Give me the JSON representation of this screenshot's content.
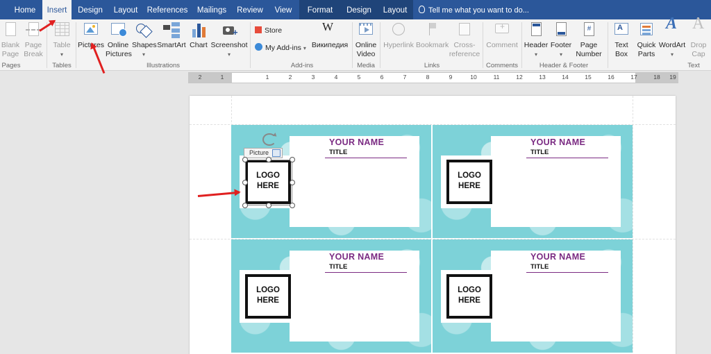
{
  "tabs": [
    {
      "label": "Home"
    },
    {
      "label": "Insert"
    },
    {
      "label": "Design"
    },
    {
      "label": "Layout"
    },
    {
      "label": "References"
    },
    {
      "label": "Mailings"
    },
    {
      "label": "Review"
    },
    {
      "label": "View"
    },
    {
      "label": "Format"
    },
    {
      "label": "Design"
    },
    {
      "label": "Layout"
    }
  ],
  "active_tab": "Insert",
  "tell_me": "Tell me what you want to do...",
  "ribbon": {
    "pages": {
      "label": "Pages",
      "blank": [
        "Blank",
        "Page"
      ],
      "break": [
        "Page",
        "Break"
      ]
    },
    "tables": {
      "label": "Tables",
      "table": "Table"
    },
    "illustrations": {
      "label": "Illustrations",
      "pictures": "Pictures",
      "online_pictures": [
        "Online",
        "Pictures"
      ],
      "shapes": "Shapes",
      "smartart": "SmartArt",
      "chart": "Chart",
      "screenshot": "Screenshot"
    },
    "addins": {
      "label": "Add-ins",
      "store": "Store",
      "my_addins": "My Add-ins",
      "wiki": "Википедия",
      "wiki_glyph": "W"
    },
    "media": {
      "label": "Media",
      "online_video": [
        "Online",
        "Video"
      ]
    },
    "links": {
      "label": "Links",
      "hyperlink": "Hyperlink",
      "bookmark": "Bookmark",
      "cross_reference": [
        "Cross-",
        "reference"
      ]
    },
    "comments": {
      "label": "Comments",
      "comment": "Comment"
    },
    "header_footer": {
      "label": "Header & Footer",
      "header": "Header",
      "footer": "Footer",
      "page_number": [
        "Page",
        "Number"
      ],
      "pn_glyph": "#"
    },
    "text": {
      "label": "Text",
      "text_box": [
        "Text",
        "Box"
      ],
      "quick_parts": [
        "Quick",
        "Parts"
      ],
      "wordart": "WordArt",
      "drop_cap": [
        "Drop",
        "Cap"
      ]
    }
  },
  "ruler": {
    "left_numbers": [
      "2",
      "1"
    ],
    "right_numbers": [
      "1",
      "2",
      "3",
      "4",
      "5",
      "6",
      "7",
      "8",
      "9",
      "10",
      "11",
      "12",
      "13",
      "14",
      "15",
      "16",
      "17",
      "18",
      "19"
    ]
  },
  "cards": [
    {
      "name": "YOUR NAME",
      "title": "TITLE",
      "logo": [
        "LOGO",
        "HERE"
      ]
    },
    {
      "name": "YOUR NAME",
      "title": "TITLE",
      "logo": [
        "LOGO",
        "HERE"
      ]
    },
    {
      "name": "YOUR NAME",
      "title": "TITLE",
      "logo": [
        "LOGO",
        "HERE"
      ]
    },
    {
      "name": "YOUR NAME",
      "title": "TITLE",
      "logo": [
        "LOGO",
        "HERE"
      ]
    }
  ],
  "picture_label": "Picture",
  "colors": {
    "ribbon_tab_bar": "#2b579a",
    "card_name": "#7a2a82",
    "card_bg": "#7dd2d8",
    "annotation_arrow": "#e02020"
  },
  "icons": [
    "lightbulb-icon",
    "blank-page-icon",
    "page-break-icon",
    "table-icon",
    "pictures-icon",
    "online-pictures-icon",
    "shapes-icon",
    "smartart-icon",
    "chart-icon",
    "screenshot-icon",
    "store-icon",
    "my-addins-icon",
    "wikipedia-icon",
    "online-video-icon",
    "hyperlink-icon",
    "bookmark-icon",
    "cross-reference-icon",
    "comment-icon",
    "header-icon",
    "footer-icon",
    "page-number-icon",
    "text-box-icon",
    "quick-parts-icon",
    "wordart-icon",
    "drop-cap-icon",
    "rotate-handle-icon",
    "layout-options-icon"
  ]
}
